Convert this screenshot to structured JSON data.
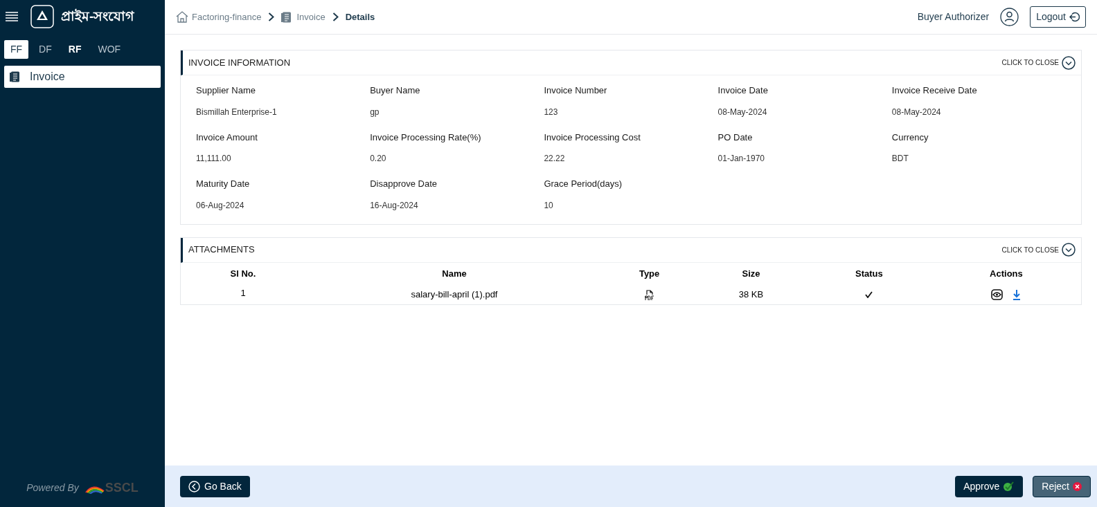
{
  "brand": {
    "title": "প্রাইম-সংযোগ"
  },
  "module_tabs": [
    {
      "label": "FF",
      "selected": true,
      "highlighted": false
    },
    {
      "label": "DF",
      "selected": false,
      "highlighted": false
    },
    {
      "label": "RF",
      "selected": false,
      "highlighted": true
    },
    {
      "label": "WOF",
      "selected": false,
      "highlighted": false
    }
  ],
  "sidebar": {
    "items": [
      {
        "label": "Invoice",
        "selected": true
      }
    ]
  },
  "footer_brand": {
    "powered_by": "Powered By",
    "logo_text": "SSCL"
  },
  "breadcrumb": [
    {
      "label": "Factoring-finance",
      "kind": "home"
    },
    {
      "label": "Invoice",
      "kind": "doc"
    },
    {
      "label": "Details",
      "kind": "current"
    }
  ],
  "user": {
    "role": "Buyer Authorizer",
    "logout": "Logout"
  },
  "invoice_information": {
    "title": "INVOICE INFORMATION",
    "toggle": "CLICK TO CLOSE",
    "fields": [
      {
        "label": "Supplier Name",
        "value": "Bismillah Enterprise-1"
      },
      {
        "label": "Buyer Name",
        "value": "gp"
      },
      {
        "label": "Invoice Number",
        "value": "123"
      },
      {
        "label": "Invoice Date",
        "value": "08-May-2024"
      },
      {
        "label": "Invoice Receive Date",
        "value": "08-May-2024"
      },
      {
        "label": "Invoice Amount",
        "value": "11,111.00"
      },
      {
        "label": "Invoice Processing Rate(%)",
        "value": "0.20"
      },
      {
        "label": "Invoice Processing Cost",
        "value": "22.22"
      },
      {
        "label": "PO Date",
        "value": "01-Jan-1970"
      },
      {
        "label": "Currency",
        "value": "BDT"
      },
      {
        "label": "Maturity Date",
        "value": "06-Aug-2024"
      },
      {
        "label": "Disapprove Date",
        "value": "16-Aug-2024"
      },
      {
        "label": "Grace Period(days)",
        "value": "10"
      }
    ]
  },
  "attachments": {
    "title": "ATTACHMENTS",
    "toggle": "CLICK TO CLOSE",
    "columns": [
      "Sl No.",
      "Name",
      "Type",
      "Size",
      "Status",
      "Actions"
    ],
    "rows": [
      {
        "sl": "1",
        "name": "salary-bill-april (1).pdf",
        "size": "38 KB",
        "verified": true
      }
    ]
  },
  "actions": {
    "back": "Go Back",
    "approve": "Approve",
    "reject": "Reject"
  }
}
